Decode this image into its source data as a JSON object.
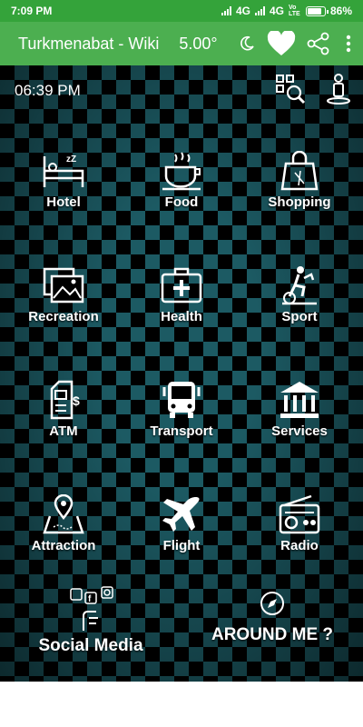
{
  "status_bar": {
    "time": "7:09 PM",
    "network1": "4G",
    "network2": "4G",
    "volte": "Vo LTE",
    "battery": "86%",
    "battery_level": 0.86
  },
  "app_bar": {
    "title": "Turkmenabat - Wiki",
    "temperature": "5.00°"
  },
  "main": {
    "time": "06:39 PM",
    "categories": [
      {
        "label": "Hotel",
        "icon": "bed-icon"
      },
      {
        "label": "Food",
        "icon": "coffee-cup-icon"
      },
      {
        "label": "Shopping",
        "icon": "shopping-bag-icon"
      },
      {
        "label": "Recreation",
        "icon": "picture-icon"
      },
      {
        "label": "Health",
        "icon": "first-aid-kit-icon"
      },
      {
        "label": "Sport",
        "icon": "exercise-bike-icon"
      },
      {
        "label": "ATM",
        "icon": "atm-machine-icon"
      },
      {
        "label": "Transport",
        "icon": "bus-icon"
      },
      {
        "label": "Services",
        "icon": "bank-building-icon"
      },
      {
        "label": "Attraction",
        "icon": "map-pin-icon"
      },
      {
        "label": "Flight",
        "icon": "airplane-icon"
      },
      {
        "label": "Radio",
        "icon": "radio-icon"
      }
    ],
    "social_media": "Social Media",
    "around_me": "AROUND ME ?"
  }
}
